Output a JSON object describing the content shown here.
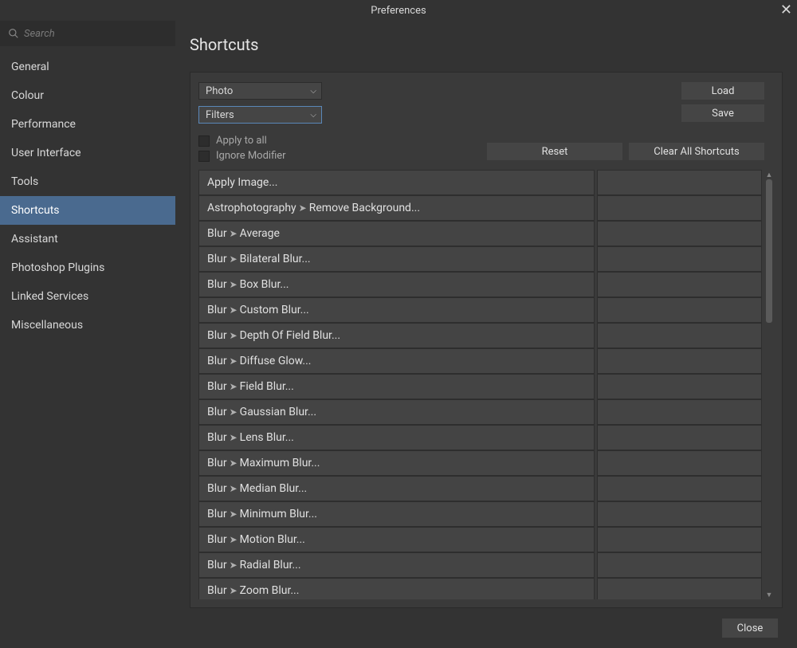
{
  "window": {
    "title": "Preferences"
  },
  "search": {
    "placeholder": "Search"
  },
  "sidebar": {
    "items": [
      {
        "label": "General"
      },
      {
        "label": "Colour"
      },
      {
        "label": "Performance"
      },
      {
        "label": "User Interface"
      },
      {
        "label": "Tools"
      },
      {
        "label": "Shortcuts"
      },
      {
        "label": "Assistant"
      },
      {
        "label": "Photoshop Plugins"
      },
      {
        "label": "Linked Services"
      },
      {
        "label": "Miscellaneous"
      }
    ],
    "active_index": 5
  },
  "page": {
    "title": "Shortcuts"
  },
  "controls": {
    "persona_select": "Photo",
    "category_select": "Filters",
    "load_label": "Load",
    "save_label": "Save",
    "apply_to_all_label": "Apply to all",
    "ignore_modifier_label": "Ignore Modifier",
    "reset_label": "Reset",
    "clear_all_label": "Clear All Shortcuts"
  },
  "shortcuts": [
    {
      "name": "Apply Image...",
      "path": null,
      "shortcut": ""
    },
    {
      "name": "Remove Background...",
      "path": "Astrophotography",
      "shortcut": ""
    },
    {
      "name": "Average",
      "path": "Blur",
      "shortcut": ""
    },
    {
      "name": "Bilateral Blur...",
      "path": "Blur",
      "shortcut": ""
    },
    {
      "name": "Box Blur...",
      "path": "Blur",
      "shortcut": ""
    },
    {
      "name": "Custom Blur...",
      "path": "Blur",
      "shortcut": ""
    },
    {
      "name": "Depth Of Field Blur...",
      "path": "Blur",
      "shortcut": ""
    },
    {
      "name": "Diffuse Glow...",
      "path": "Blur",
      "shortcut": ""
    },
    {
      "name": "Field Blur...",
      "path": "Blur",
      "shortcut": ""
    },
    {
      "name": "Gaussian Blur...",
      "path": "Blur",
      "shortcut": ""
    },
    {
      "name": "Lens Blur...",
      "path": "Blur",
      "shortcut": ""
    },
    {
      "name": "Maximum Blur...",
      "path": "Blur",
      "shortcut": ""
    },
    {
      "name": "Median Blur...",
      "path": "Blur",
      "shortcut": ""
    },
    {
      "name": "Minimum Blur...",
      "path": "Blur",
      "shortcut": ""
    },
    {
      "name": "Motion Blur...",
      "path": "Blur",
      "shortcut": ""
    },
    {
      "name": "Radial Blur...",
      "path": "Blur",
      "shortcut": ""
    },
    {
      "name": "Zoom Blur...",
      "path": "Blur",
      "shortcut": ""
    }
  ],
  "footer": {
    "close_label": "Close"
  }
}
